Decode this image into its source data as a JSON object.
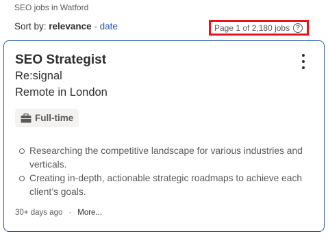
{
  "search": {
    "title": "SEO jobs in Watford"
  },
  "sort": {
    "label": "Sort by:",
    "active": "relevance",
    "separator": "-",
    "alternative": "date"
  },
  "pagination": {
    "text": "Page 1 of 2,180 jobs",
    "help_icon": "?"
  },
  "job": {
    "title": "SEO Strategist",
    "company": "Re:signal",
    "location": "Remote in London",
    "job_type": "Full-time",
    "snippet": [
      "Researching the competitive landscape for various industries and verticals.",
      "Creating in-depth, actionable strategic roadmaps to achieve each client’s goals."
    ],
    "posted": "30+ days ago",
    "separator": "·",
    "more_label": "More..."
  },
  "colors": {
    "link": "#2557a7",
    "highlight_box": "#e8141c",
    "card_border": "#2557a7",
    "tag_bg": "#f3f2f1"
  },
  "icons": {
    "help": "help-circle-icon",
    "menu": "kebab-menu-icon",
    "job_type": "briefcase-icon"
  }
}
